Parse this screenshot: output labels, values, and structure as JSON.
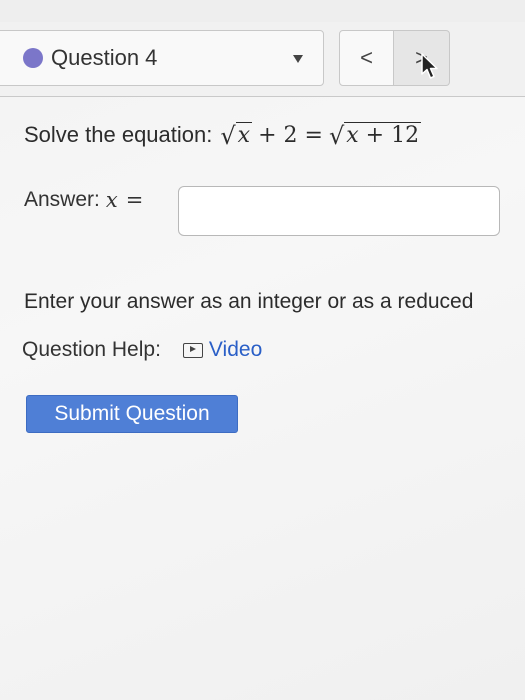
{
  "header": {
    "question_label": "Question 4",
    "status_color": "#7b76c9",
    "prev_label": "<",
    "next_label": ">"
  },
  "question": {
    "prompt": "Solve the equation:",
    "equation": {
      "lhs_radicand": "x",
      "lhs_rest": "+ 2 =",
      "rhs_radicand_var": "x",
      "rhs_radicand_rest": "+ 12"
    }
  },
  "answer": {
    "label": "Answer:",
    "variable": "x",
    "equals": "=",
    "value": "",
    "placeholder": ""
  },
  "instruction": "Enter your answer as an integer or as a reduced",
  "help": {
    "label": "Question Help:",
    "video_label": "Video"
  },
  "submit": {
    "label": "Submit Question",
    "color": "#4f7fd6"
  },
  "icons": {
    "status": "status-dot",
    "dropdown": "caret-down-icon",
    "prev": "chevron-left-icon",
    "next": "chevron-right-icon",
    "video": "video-play-icon",
    "cursor": "mouse-cursor-icon"
  }
}
